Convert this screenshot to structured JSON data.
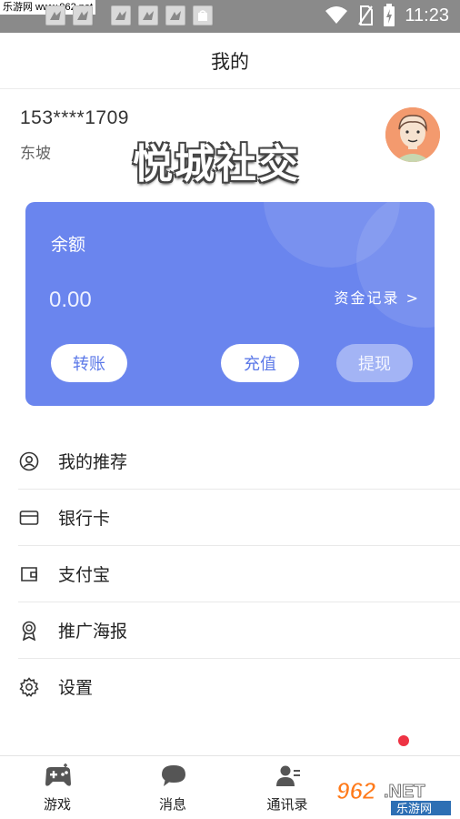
{
  "status_bar": {
    "watermark_site": "乐游网 www.962.net",
    "time": "11:23",
    "colors": {
      "background": "#8a8a8a"
    }
  },
  "header": {
    "title": "我的"
  },
  "profile": {
    "phone": "153****1709",
    "nickname": "东坡",
    "overlay_text": "悦城社交",
    "avatar_icon": "cartoon-avatar-icon"
  },
  "wallet": {
    "balance_label": "余额",
    "balance_value": "0.00",
    "records_link": "资金记录 >",
    "buttons": {
      "transfer": "转账",
      "recharge": "充值",
      "withdraw": "提现"
    },
    "colors": {
      "card": "#6a85ee",
      "button_text": "#5c79e8",
      "withdraw_disabled": "#a3b4f5"
    }
  },
  "menu": {
    "items": [
      {
        "label": "我的推荐",
        "icon": "user-circle-icon"
      },
      {
        "label": "银行卡",
        "icon": "bank-card-icon"
      },
      {
        "label": "支付宝",
        "icon": "wallet-icon"
      },
      {
        "label": "推广海报",
        "icon": "award-badge-icon"
      },
      {
        "label": "设置",
        "icon": "gear-icon"
      }
    ]
  },
  "bottom_nav": {
    "tabs": [
      {
        "label": "游戏",
        "icon": "gamepad-icon"
      },
      {
        "label": "消息",
        "icon": "chat-bubble-icon"
      },
      {
        "label": "通讯录",
        "icon": "contacts-icon"
      }
    ],
    "badge_color": "#ee3344"
  },
  "corner_watermark": {
    "text_962": "962",
    "text_net": ".NET",
    "text_cn": "乐游网"
  }
}
